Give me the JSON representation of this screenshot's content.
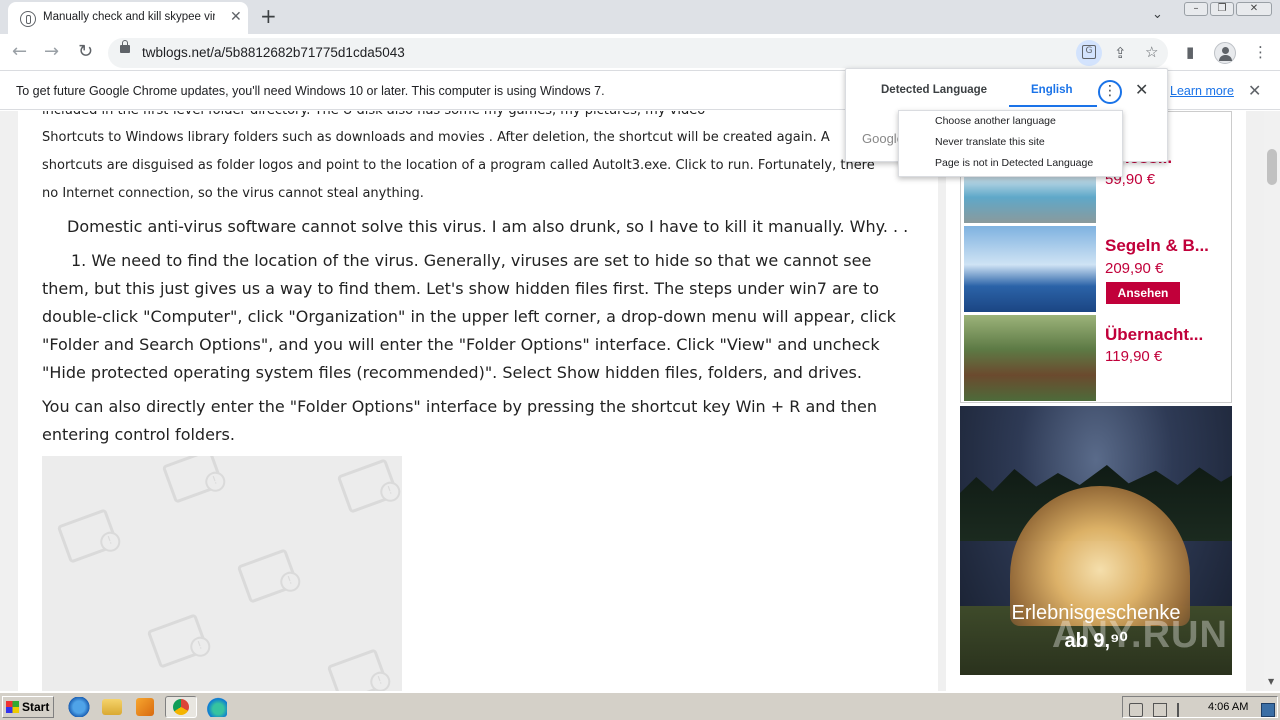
{
  "browser": {
    "tab_title": "Manually check and kill skypee virus",
    "tab_close_icon": "close-icon",
    "new_tab_label": "+",
    "tab_menu_icon": "chevron-down-icon",
    "url": "twblogs.net/a/5b8812682b71775d1cda5043",
    "window_buttons": [
      "minimize",
      "restore",
      "close"
    ]
  },
  "infobar": {
    "message": "To get future Google Chrome updates, you'll need Windows 10 or later. This computer is using Windows 7.",
    "link": "Learn more"
  },
  "translate_popup": {
    "tab_source": "Detected Language",
    "tab_target": "English",
    "google_label": "Google",
    "menu_items": [
      "Choose another language",
      "Never translate this site",
      "Page is not in Detected Language"
    ]
  },
  "article": {
    "line_cut_top": "included in the first-level folder directory. The U disk also has some my games, my pictures, my video",
    "line1": "Shortcuts to Windows library folders such as downloads and movies . After deletion, the shortcut will be created again. A",
    "line2": "shortcuts are disguised as folder logos and point to the location of a program called AutoIt3.exe. Click to run. Fortunately, there",
    "line3": "no Internet connection, so the virus cannot steal anything.",
    "para2": "Domestic anti-virus software cannot solve this virus. I am also drunk, so I have to kill it manually. Why. . .",
    "para3_l1": "1. We need to find the location of the virus. Generally, viruses are set to hide so that we cannot see",
    "para3_l2": "them, but this just gives us a way to find them. Let's show hidden files first. The steps under win7 are to",
    "para3_l3": "double-click \"Computer\", click \"Organization\" in the upper left corner, a drop-down menu will appear, click",
    "para3_l4": "\"Folder and Search Options\", and you will enter the \"Folder Options\" interface. Click \"View\" and uncheck",
    "para3_l5": "\"Hide protected operating system files (recommended)\". Select Show hidden files, folders, and drives.",
    "para4_l1": "You can also directly enter the \"Folder Options\" interface by pressing the shortcut key Win + R and then",
    "para4_l2": "entering control folders."
  },
  "ads": {
    "item1": {
      "title": "...ness...",
      "price": "59,90 €"
    },
    "item2": {
      "title": "Segeln & B...",
      "price": "209,90 €",
      "button": "Ansehen"
    },
    "item3": {
      "title": "Übernacht...",
      "price": "119,90 €"
    },
    "banner_line1": "Erlebnisgeschenke",
    "banner_line2": "ab 9,⁹⁰",
    "watermark": "ANY.RUN"
  },
  "taskbar": {
    "start_label": "Start",
    "clock": "4:06 AM",
    "apps": [
      "ie-icon",
      "explorer-icon",
      "media-player-icon",
      "chrome-icon",
      "edge-icon"
    ]
  },
  "colors": {
    "accent": "#1a73e8",
    "ad_red": "#c1003a",
    "taskbar": "#d4d0c8"
  }
}
